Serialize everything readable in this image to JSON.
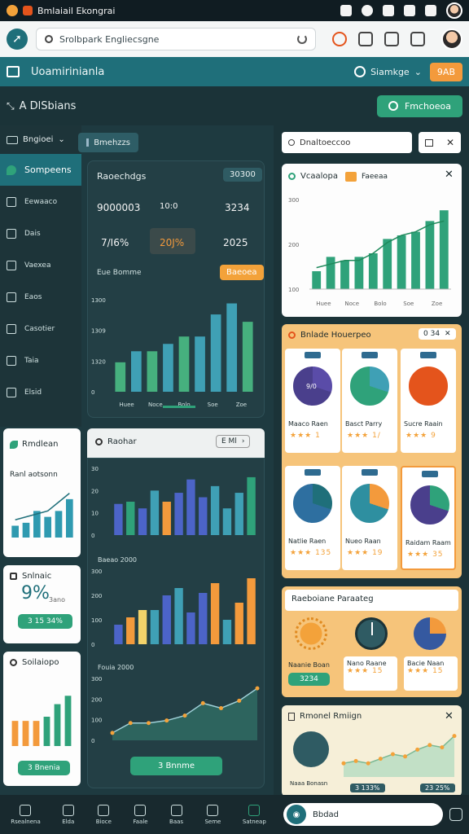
{
  "statusbar": {
    "title": "Bmlaiail Ekongrai"
  },
  "toolbar": {
    "search_placeholder": "Srolbpark Engliecsgne"
  },
  "app": {
    "title": "Uoamirinianla",
    "lang_label": "Siamkge",
    "lang_btn": "9AB"
  },
  "section": {
    "title": "A DlSbians",
    "action": "Fmchoeoa"
  },
  "sidebar": {
    "top": "Bngioei",
    "chip": "Bmehzzs",
    "items": [
      {
        "label": "Sompeens",
        "icon": "shield-icon"
      },
      {
        "label": "Eewaaco",
        "icon": "car-icon"
      },
      {
        "label": "Dais",
        "icon": "plane-icon"
      },
      {
        "label": "Vaexea",
        "icon": "laptop-icon"
      },
      {
        "label": "Eaos",
        "icon": "cloud-icon"
      },
      {
        "label": "Casotier",
        "icon": "user-icon"
      },
      {
        "label": "Taia",
        "icon": "phone-icon"
      },
      {
        "label": "Elsid",
        "icon": "mail-icon"
      }
    ]
  },
  "main_card": {
    "title": "Raoechdgs",
    "tag": "30300",
    "kpis": [
      "9000003",
      "10:0",
      "3234",
      "7/I6%",
      "20J%",
      "2025"
    ],
    "sub": "Eue Bomme",
    "sub_tag": "Baeoea",
    "y_ticks": [
      "1300",
      "1309",
      "1320",
      "0"
    ],
    "x_ticks": [
      "Huee",
      "Noce",
      "Bolo",
      "Soe",
      "Zoe"
    ],
    "chart_data": {
      "type": "bar",
      "values": [
        8,
        11,
        11,
        13,
        15,
        15,
        21,
        24,
        19
      ],
      "colors": [
        "#46b07e",
        "#3fa0b5",
        "#46b07e",
        "#3fa0b5",
        "#46b07e",
        "#3fa0b5",
        "#3fa0b5",
        "#3fa0b5",
        "#46b07e"
      ],
      "ylim": [
        0,
        25
      ]
    }
  },
  "left_cards": [
    {
      "title": "Rmdlean",
      "sub": "Ranl aotsonn",
      "icon": "leaf-icon",
      "chart_data": {
        "type": "bar",
        "values": [
          4,
          5,
          9,
          7,
          9,
          13
        ],
        "ylim": [
          0,
          16
        ],
        "line": [
          6,
          7,
          8,
          9,
          12,
          15
        ]
      }
    },
    {
      "title": "Snlnaic",
      "big": "9%",
      "small": "3ano",
      "btn": "3 15 34%",
      "icon": "lock-icon"
    },
    {
      "title": "Soilaiopo",
      "btn": "3 Bnenia",
      "icon": "search-icon",
      "chart_data": {
        "type": "bar",
        "values": [
          6,
          6,
          6,
          7,
          10,
          12
        ],
        "colors": [
          "#f39a3c",
          "#f39a3c",
          "#f39a3c",
          "#2fa27a",
          "#2fa27a",
          "#2fa27a"
        ],
        "ylim": [
          0,
          14
        ]
      }
    }
  ],
  "report_card": {
    "title": "Raohar",
    "nav": "E Ml",
    "ticks_1": [
      "30",
      "20",
      "10",
      "0"
    ],
    "chart_1": {
      "type": "bar",
      "values": [
        14,
        15,
        12,
        20,
        15,
        19,
        25,
        17,
        22,
        12,
        19,
        26
      ],
      "colors": [
        "#4c64c8",
        "#2fa27a",
        "#4c64c8",
        "#3fa0b5",
        "#f39a3c",
        "#4c64c8",
        "#4c64c8",
        "#4c64c8",
        "#3fa0b5",
        "#3fa0b5",
        "#3fa0b5",
        "#2fa27a"
      ],
      "ylim": [
        0,
        30
      ]
    },
    "label_2": "Baeao 2000",
    "ticks_2": [
      "300",
      "200",
      "100",
      "0"
    ],
    "chart_2": {
      "type": "bar",
      "values": [
        8,
        11,
        14,
        14,
        20,
        23,
        13,
        21,
        25,
        10,
        17,
        27
      ],
      "colors": [
        "#4c64c8",
        "#f39a3c",
        "#f3d36a",
        "#3fa0b5",
        "#4c64c8",
        "#3fa0b5",
        "#4c64c8",
        "#4c64c8",
        "#f39a3c",
        "#3fa0b5",
        "#f39a3c",
        "#f39a3c"
      ],
      "ylim": [
        0,
        30
      ]
    },
    "label_3": "Fouia 2000",
    "ticks_3": [
      "300",
      "200",
      "100",
      "0"
    ],
    "chart_3": {
      "type": "area",
      "values": [
        3,
        7,
        7,
        8,
        10,
        15,
        13,
        16,
        21
      ],
      "ylim": [
        0,
        25
      ]
    },
    "btn": "3 Bnnme"
  },
  "right_chart_card": {
    "search": "Dnaltoeccoo",
    "title": "Vcaalopa",
    "tag": "Faeeaa",
    "y_ticks": [
      "300",
      "200",
      "100"
    ],
    "x_ticks": [
      "Huee",
      "Noce",
      "Bolo",
      "Soe",
      "Zoe"
    ],
    "chart_data": {
      "type": "bar",
      "values": [
        5,
        9,
        8,
        9,
        10,
        14,
        15,
        16,
        19,
        22
      ],
      "line": [
        6,
        7,
        8,
        8,
        10,
        13,
        15,
        16,
        18,
        19
      ],
      "ylim": [
        0,
        25
      ]
    }
  },
  "pie_card": {
    "title": "Bnlade Houerpeo",
    "filter": "0 34",
    "tiles": [
      {
        "label": "Maaco Raen",
        "stars": "★★★ 1",
        "colors": [
          "#4a3f8c",
          "#5a4ca8"
        ],
        "value": "9/0"
      },
      {
        "label": "Basct Parry",
        "stars": "★★★ 1/",
        "colors": [
          "#2fa27a",
          "#3fa0b5"
        ],
        "value": ""
      },
      {
        "label": "Sucre Raain",
        "stars": "★★★ 9",
        "colors": [
          "#e4541c",
          "#e4541c"
        ],
        "value": ""
      },
      {
        "label": "Natlie Raen",
        "stars": "★★★ 135",
        "colors": [
          "#2e6fa0",
          "#1f6f7a"
        ],
        "value": ""
      },
      {
        "label": "Nueo Raan",
        "stars": "★★★ 19",
        "colors": [
          "#2e8fa0",
          "#f39a3c"
        ],
        "value": ""
      },
      {
        "label": "Raidam Raam",
        "stars": "★★★ 35",
        "colors": [
          "#4a3f8c",
          "#2fa27a"
        ],
        "value": ""
      }
    ]
  },
  "gauge_card": {
    "title": "Raeboiane Paraateg",
    "items": [
      {
        "label": "Naanie Boan",
        "sub": "3234"
      },
      {
        "label": "Nano Raane",
        "stars": "★★★ 15"
      },
      {
        "label": "Bacie Naan",
        "stars": "★★★ 15"
      }
    ]
  },
  "bottom_card": {
    "title": "Rmonel Rmiign",
    "label": "Naaa Bonasn",
    "tag1": "3 133%",
    "tag2": "23 25%",
    "chart_data": {
      "type": "area",
      "values": [
        6,
        7,
        6,
        8,
        10,
        9,
        12,
        14,
        13,
        18
      ],
      "ylim": [
        0,
        20
      ]
    }
  },
  "bottomnav": {
    "items": [
      "Rsealnena",
      "Elda",
      "Bioce",
      "Faale",
      "Baas",
      "Seme",
      "Satneap"
    ],
    "input": "Bbdad"
  }
}
